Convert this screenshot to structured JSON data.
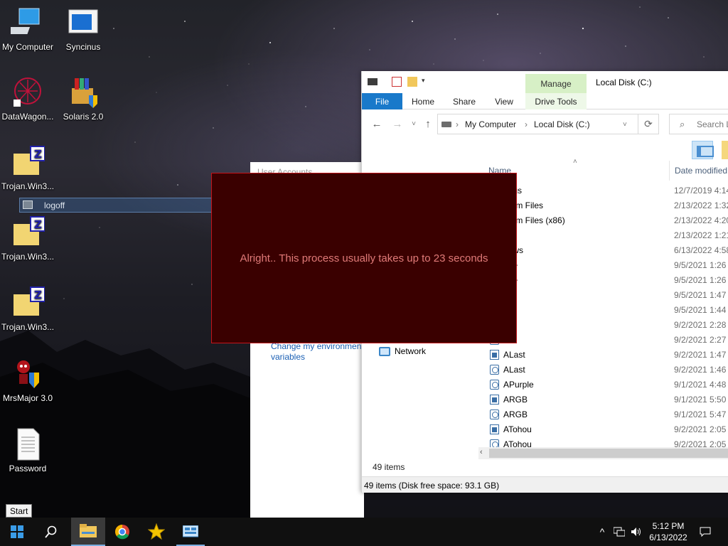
{
  "desktop": {
    "icons": [
      {
        "label": "My Computer"
      },
      {
        "label": "Syncinus"
      },
      {
        "label": "DataWagon..."
      },
      {
        "label": "Solaris 2.0"
      },
      {
        "label": "Trojan.Win3..."
      },
      {
        "label": "Trojan.Win3..."
      },
      {
        "label": "Trojan.Win3..."
      },
      {
        "label": "MrsMajor 3.0"
      },
      {
        "label": "Password"
      }
    ],
    "logoff_label": "logoff"
  },
  "user_accounts": {
    "title": "User Accounts",
    "link": "Change my environment variables"
  },
  "explorer": {
    "window_title": "Local Disk (C:)",
    "context_tab": "Manage",
    "ribbon_tabs": [
      "File",
      "Home",
      "Share",
      "View",
      "Drive Tools"
    ],
    "address": {
      "segments": [
        "My Computer",
        "Local Disk (C:)"
      ]
    },
    "search_placeholder": "Search L",
    "columns": {
      "name": "Name",
      "date": "Date modified"
    },
    "nav": {
      "network": "Network"
    },
    "files": [
      {
        "name": "Logs",
        "date": "12/7/2019 4:14",
        "icon": "folder"
      },
      {
        "name": "gram Files",
        "date": "2/13/2022 1:32",
        "icon": "folder"
      },
      {
        "name": "gram Files (x86)",
        "date": "2/13/2022 4:20",
        "icon": "folder"
      },
      {
        "name": "rs",
        "date": "2/13/2022 1:21",
        "icon": "folder"
      },
      {
        "name": "dows",
        "date": "6/13/2022 4:58",
        "icon": "folder"
      },
      {
        "name": "ube",
        "date": "9/5/2021 1:26 P",
        "icon": "exe"
      },
      {
        "name": "ube",
        "date": "9/5/2021 1:26 P",
        "icon": "scr"
      },
      {
        "name": "un",
        "date": "9/5/2021 1:47 P",
        "icon": "exe"
      },
      {
        "name": "un",
        "date": "9/5/2021 1:44 P",
        "icon": "scr"
      },
      {
        "name": "rst",
        "date": "9/2/2021 2:28 P",
        "icon": "exe"
      },
      {
        "name": "rst",
        "date": "9/2/2021 2:27 P",
        "icon": "scr"
      },
      {
        "name": "ALast",
        "date": "9/2/2021 1:47 P",
        "icon": "exe"
      },
      {
        "name": "ALast",
        "date": "9/2/2021 1:46 P",
        "icon": "scr"
      },
      {
        "name": "APurple",
        "date": "9/1/2021 4:48 P",
        "icon": "scr"
      },
      {
        "name": "ARGB",
        "date": "9/1/2021 5:50 P",
        "icon": "exe"
      },
      {
        "name": "ARGB",
        "date": "9/1/2021 5:47 P",
        "icon": "scr"
      },
      {
        "name": "ATohou",
        "date": "9/2/2021 2:05 P",
        "icon": "exe"
      },
      {
        "name": "ATohou",
        "date": "9/2/2021 2:05 P",
        "icon": "scr"
      }
    ],
    "item_count": "49 items",
    "status": "49 items (Disk free space: 93.1 GB)"
  },
  "overlay": {
    "message": "Alright.. This process usually takes up to 23 seconds",
    "bg_color": "#3a0000",
    "text_color": "#e07a78"
  },
  "start_tooltip": "Start",
  "taskbar": {
    "items": [
      "start-icon",
      "search-icon",
      "file-explorer-icon",
      "chrome-icon",
      "star-app-icon",
      "control-panel-icon"
    ],
    "clock_time": "5:12 PM",
    "clock_date": "6/13/2022"
  }
}
